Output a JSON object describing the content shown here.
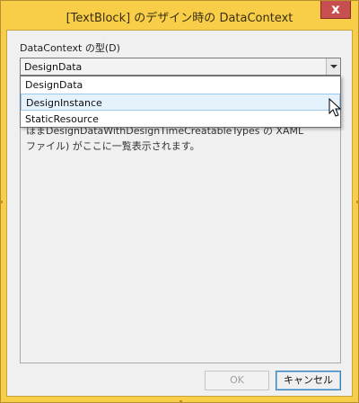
{
  "window": {
    "title": "[TextBlock] のデザイン時の DataContext",
    "close_label": "x"
  },
  "form": {
    "type_label": "DataContext の型(D)",
    "combo_value": "DesignData"
  },
  "dropdown": {
    "items": [
      "DesignData",
      "DesignInstance",
      "StaticResource"
    ],
    "hovered_index": 1
  },
  "description": {
    "lines": [
      "ほまDesignDataWithDesignTimeCreatableTypes の XAML",
      "ファイル) がここに一覧表示されます。"
    ]
  },
  "buttons": {
    "ok_label": "OK",
    "cancel_label": "キャンセル"
  },
  "colors": {
    "title_bar": "#f8ce48",
    "close_button": "#c74f4f",
    "hover_highlight": "#e5f1fb"
  }
}
